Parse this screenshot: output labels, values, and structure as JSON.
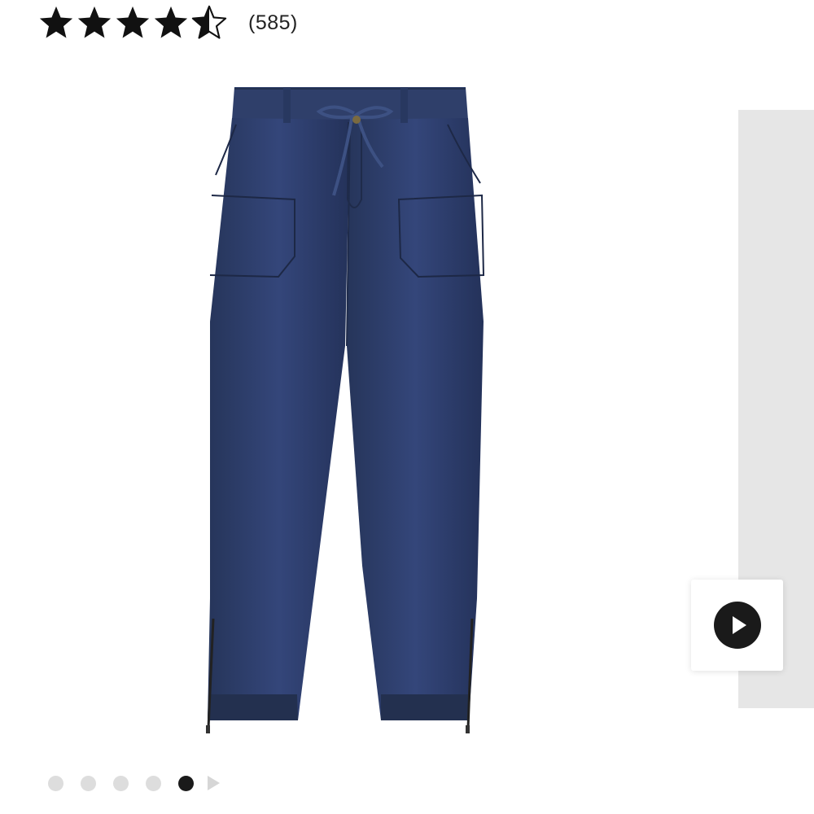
{
  "rating": {
    "value": 4.5,
    "max": 5,
    "review_count": "(585)",
    "star_color": "#111111"
  },
  "product": {
    "image_icon": "pants-product-image",
    "pants_color": "#2c3b62"
  },
  "video": {
    "icon": "play-icon"
  },
  "carousel": {
    "total": 5,
    "active_index": 4,
    "next_icon": "chevron-right-icon"
  }
}
